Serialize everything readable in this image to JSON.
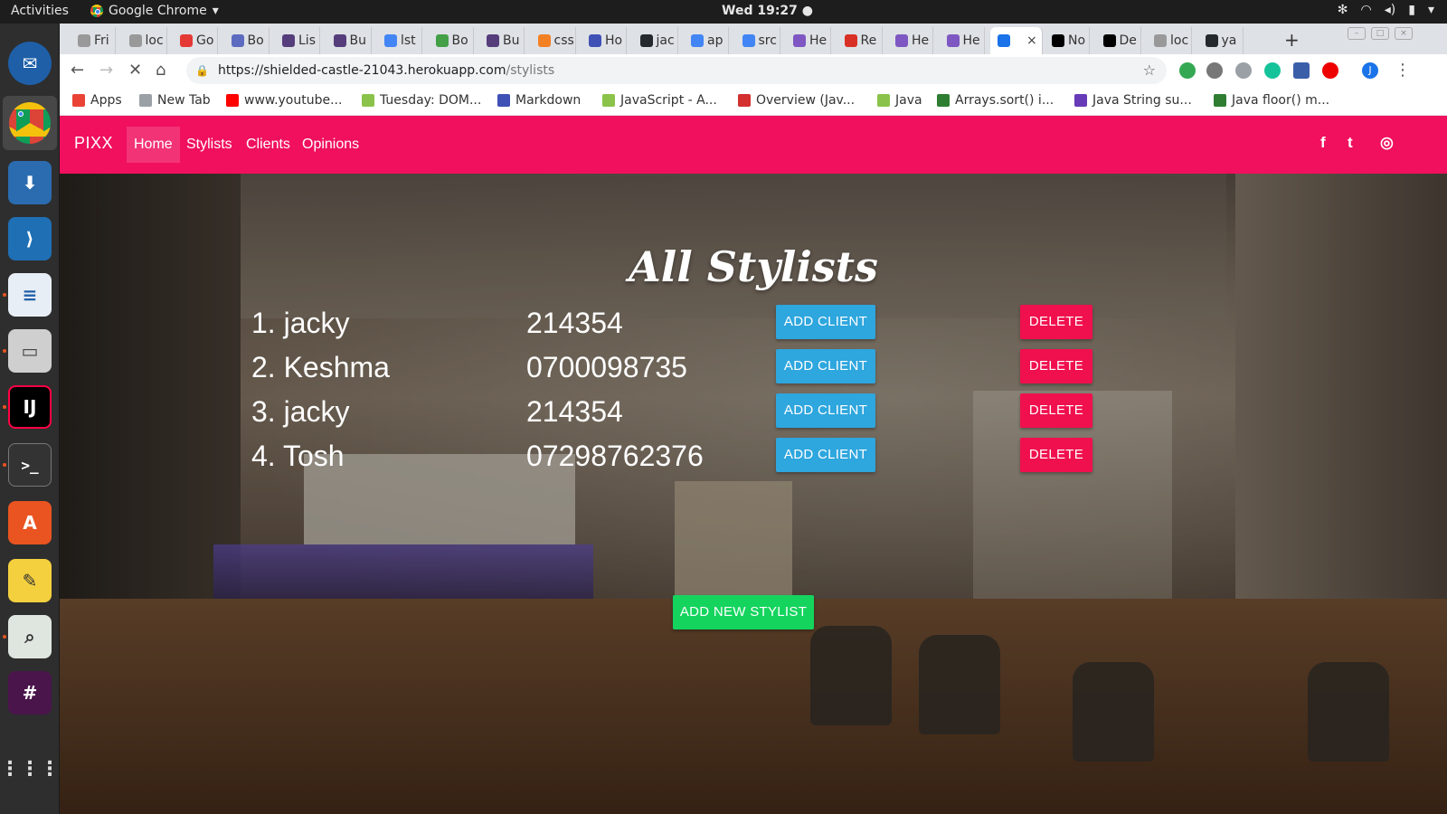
{
  "system": {
    "activities": "Activities",
    "app_name": "Google Chrome",
    "clock": "Wed 19:27 ●"
  },
  "browser": {
    "tabs": [
      {
        "label": "Fri",
        "color": "#999999"
      },
      {
        "label": "loc",
        "color": "#999999"
      },
      {
        "label": "Go",
        "color": "#e53935"
      },
      {
        "label": "Bo",
        "color": "#5c6bc0"
      },
      {
        "label": "Lis",
        "color": "#563d7c"
      },
      {
        "label": "Bu",
        "color": "#563d7c"
      },
      {
        "label": "lst",
        "color": "#4285f4"
      },
      {
        "label": "Bo",
        "color": "#43a047"
      },
      {
        "label": "Bu",
        "color": "#563d7c"
      },
      {
        "label": "css",
        "color": "#f48024"
      },
      {
        "label": "Ho",
        "color": "#3f51b5"
      },
      {
        "label": "jac",
        "color": "#24292e"
      },
      {
        "label": "ap",
        "color": "#4285f4"
      },
      {
        "label": "src",
        "color": "#4285f4"
      },
      {
        "label": "He",
        "color": "#7e57c2"
      },
      {
        "label": "Re",
        "color": "#d93025"
      },
      {
        "label": "He",
        "color": "#7e57c2"
      },
      {
        "label": "He",
        "color": "#7e57c2"
      },
      {
        "label": "",
        "color": "#1a73e8"
      },
      {
        "label": "No",
        "color": "#000000"
      },
      {
        "label": "De",
        "color": "#000000"
      },
      {
        "label": "loc",
        "color": "#999999"
      },
      {
        "label": "ya",
        "color": "#24292e"
      }
    ],
    "active_tab_close": "×",
    "new_tab": "+",
    "url_host": "https://shielded-castle-21043.herokuapp.com",
    "url_path": "/stylists",
    "bookmarks": [
      {
        "label": "Apps"
      },
      {
        "label": "New Tab"
      },
      {
        "label": "www.youtube..."
      },
      {
        "label": "Tuesday: DOM..."
      },
      {
        "label": "Markdown"
      },
      {
        "label": "JavaScript - A..."
      },
      {
        "label": "Overview (Jav..."
      },
      {
        "label": "Java"
      },
      {
        "label": "Arrays.sort() i..."
      },
      {
        "label": "Java String su..."
      },
      {
        "label": "Java floor() m..."
      }
    ]
  },
  "site": {
    "brand": "PIXX",
    "nav": [
      {
        "label": "Home",
        "active": true
      },
      {
        "label": "Stylists",
        "active": false
      },
      {
        "label": "Clients",
        "active": false
      },
      {
        "label": "Opinions",
        "active": false
      }
    ],
    "social": [
      "f",
      "t",
      "◎"
    ],
    "title": "All Stylists",
    "stylists": [
      {
        "name": "1. jacky",
        "phone": "214354"
      },
      {
        "name": "2. Keshma",
        "phone": "0700098735"
      },
      {
        "name": "3. jacky",
        "phone": "214354"
      },
      {
        "name": "4. Tosh",
        "phone": "07298762376"
      }
    ],
    "add_client_label": "ADD CLIENT",
    "delete_label": "DELETE",
    "add_stylist_label": "ADD NEW STYLIST",
    "colors": {
      "navbar": "#f0105e",
      "add_button": "#2ea6de",
      "delete_button": "#f0104e",
      "new_button": "#14d45e"
    }
  }
}
